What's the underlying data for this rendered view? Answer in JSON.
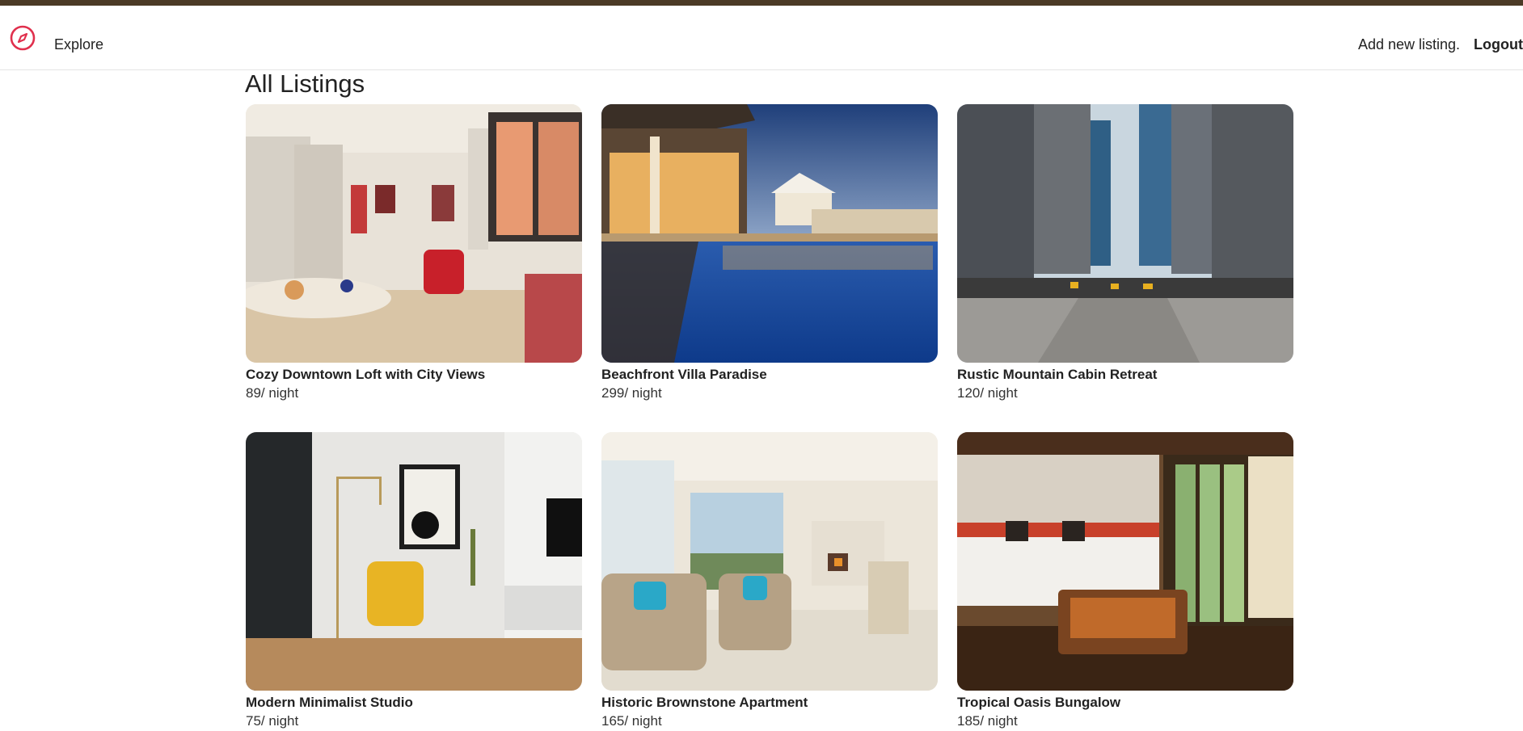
{
  "colors": {
    "accent": "#e0304d",
    "topbar": "#4b3a26"
  },
  "nav": {
    "logo_icon": "compass-icon",
    "explore_label": "Explore",
    "add_listing_label": "Add new listing.",
    "logout_label": "Logout"
  },
  "page": {
    "title": "All Listings"
  },
  "listings": [
    {
      "title": "Cozy Downtown Loft with City Views",
      "price": "89/ night",
      "image": "bright-living-room-photo"
    },
    {
      "title": "Beachfront Villa Paradise",
      "price": "299/ night",
      "image": "villa-pool-dusk-photo"
    },
    {
      "title": "Rustic Mountain Cabin Retreat",
      "price": "120/ night",
      "image": "city-street-skyscrapers-photo"
    },
    {
      "title": "Modern Minimalist Studio",
      "price": "75/ night",
      "image": "yellow-armchair-studio-photo"
    },
    {
      "title": "Historic Brownstone Apartment",
      "price": "165/ night",
      "image": "living-room-large-windows-photo"
    },
    {
      "title": "Tropical Oasis Bungalow",
      "price": "185/ night",
      "image": "tropical-bedroom-photo"
    }
  ]
}
